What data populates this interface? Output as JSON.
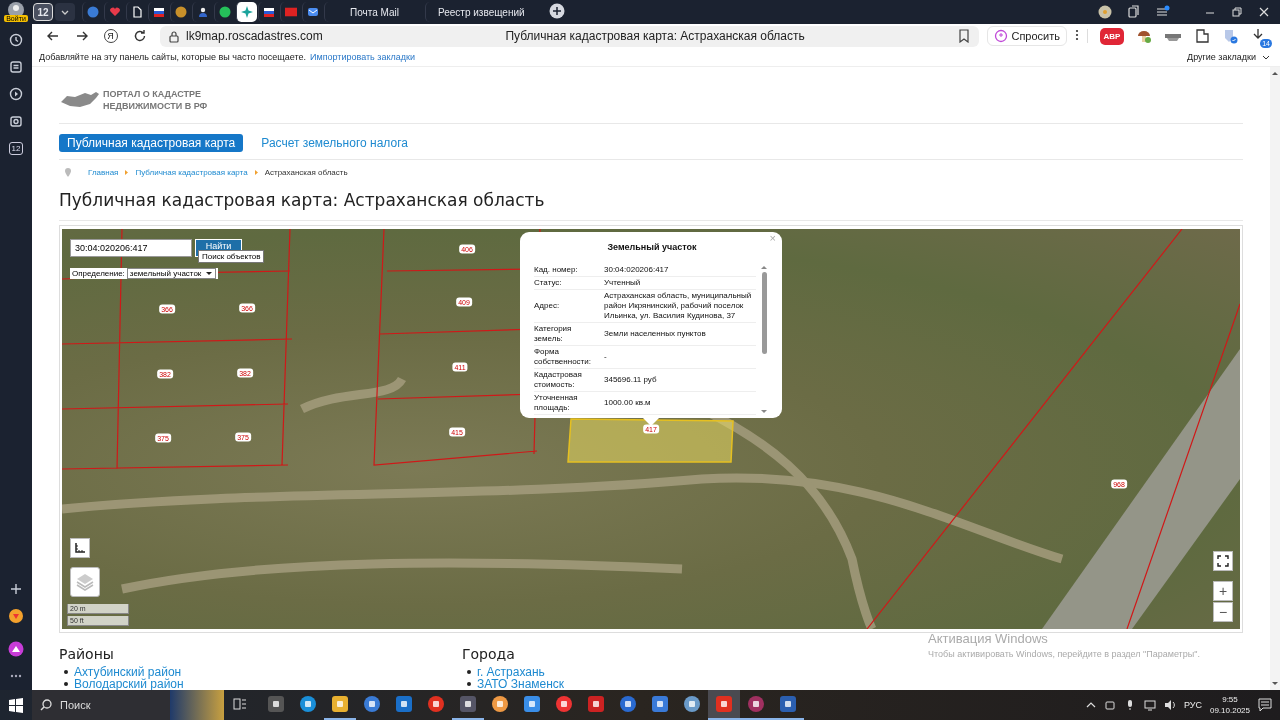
{
  "browser_sidebar": {
    "login_label": "Войти",
    "counter": "12"
  },
  "tabs": {
    "count": "12",
    "items": [
      {
        "selected": false
      },
      {
        "selected": false
      },
      {
        "selected": false
      },
      {
        "selected": false
      },
      {
        "selected": false
      },
      {
        "selected": false
      },
      {
        "selected": false
      },
      {
        "selected": true
      },
      {
        "selected": false
      },
      {
        "selected": false
      },
      {
        "selected": false
      },
      {
        "label": "Почта Mail",
        "selected": false
      },
      {
        "label": "Реестр извещений",
        "selected": false
      }
    ]
  },
  "toolbar": {
    "yandex_button": "Я",
    "url": "lk9map.roscadastres.com",
    "page_title": "Публичная кадастровая карта: Астраханская область",
    "ask_button": "Спросить",
    "adblock_label": "ABP",
    "downloads_badge": "14"
  },
  "bookmarks_bar": {
    "hint": "Добавляйте на эту панель сайты, которые вы часто посещаете.",
    "import_link": "Импортировать закладки",
    "other_bookmarks": "Другие закладки"
  },
  "site": {
    "logo_lines": [
      "ПОРТАЛ О КАДАСТРЕ",
      "НЕДВИЖИМОСТИ В РФ"
    ],
    "nav": [
      {
        "label": "Публичная кадастровая карта",
        "selected": true
      },
      {
        "label": "Расчет земельного налога",
        "selected": false
      }
    ],
    "breadcrumbs": [
      "Главная",
      "Публичная кадастровая карта",
      "Астраханская область"
    ],
    "heading": "Публичная кадастровая карта: Астраханская область"
  },
  "map": {
    "search_value": "30:04:020206:417",
    "search_button": "Найти",
    "tooltip": "Поиск объектов",
    "definition_label": "Определение:",
    "definition_value": "земельный участок",
    "parcels": [
      {
        "number": "406",
        "selected": false
      },
      {
        "number": "409",
        "selected": false
      },
      {
        "number": "366",
        "selected": false
      },
      {
        "number": "366",
        "selected": false
      },
      {
        "number": "382",
        "selected": false
      },
      {
        "number": "382",
        "selected": false
      },
      {
        "number": "411",
        "selected": false
      },
      {
        "number": "375",
        "selected": false
      },
      {
        "number": "375",
        "selected": false
      },
      {
        "number": "415",
        "selected": false
      },
      {
        "number": "417",
        "selected": true
      },
      {
        "number": "968",
        "selected": false
      }
    ],
    "scale": [
      "20 m",
      "50 ft"
    ],
    "zoom_in": "+",
    "zoom_out": "−"
  },
  "popup": {
    "title": "Земельный участок",
    "close": "×",
    "rows": [
      {
        "label": "Кад. номер:",
        "value": "30:04:020206:417"
      },
      {
        "label": "Статус:",
        "value": "Учтенный"
      },
      {
        "label": "Адрес:",
        "value": "Астраханская область, муниципальный район Икрянинский, рабочий поселок Ильинка, ул. Василия Кудинова, 37"
      },
      {
        "label": "Категория земель:",
        "value": "Земли населенных пунктов"
      },
      {
        "label": "Форма собственности:",
        "value": "-"
      },
      {
        "label": "Кадастровая стоимость:",
        "value": "345696.11 руб"
      },
      {
        "label": "Уточненная площадь:",
        "value": "1000.00 кв.м"
      }
    ]
  },
  "lists": [
    {
      "title": "Районы",
      "items": [
        "Ахтубинский район",
        "Володарский район"
      ]
    },
    {
      "title": "Города",
      "items": [
        "г. Астрахань",
        "ЗАТО Знаменск"
      ]
    }
  ],
  "activation_notice": {
    "title": "Активация Windows",
    "text": "Чтобы активировать Windows, перейдите в раздел \"Параметры\"."
  },
  "taskbar": {
    "search_placeholder": "Поиск",
    "language": "РУС",
    "time": "9:55",
    "date": "09.10.2025",
    "apps": [
      {
        "selected": false,
        "running": false
      },
      {
        "selected": false,
        "running": false
      },
      {
        "selected": false,
        "running": true
      },
      {
        "selected": false,
        "running": false
      },
      {
        "selected": false,
        "running": false
      },
      {
        "selected": false,
        "running": false
      },
      {
        "selected": false,
        "running": true
      },
      {
        "selected": false,
        "running": false
      },
      {
        "selected": false,
        "running": false
      },
      {
        "selected": false,
        "running": false
      },
      {
        "selected": false,
        "running": false
      },
      {
        "selected": false,
        "running": false
      },
      {
        "selected": false,
        "running": false
      },
      {
        "selected": false,
        "running": false
      },
      {
        "selected": true,
        "running": true
      },
      {
        "selected": false,
        "running": true
      },
      {
        "selected": false,
        "running": true
      }
    ]
  }
}
